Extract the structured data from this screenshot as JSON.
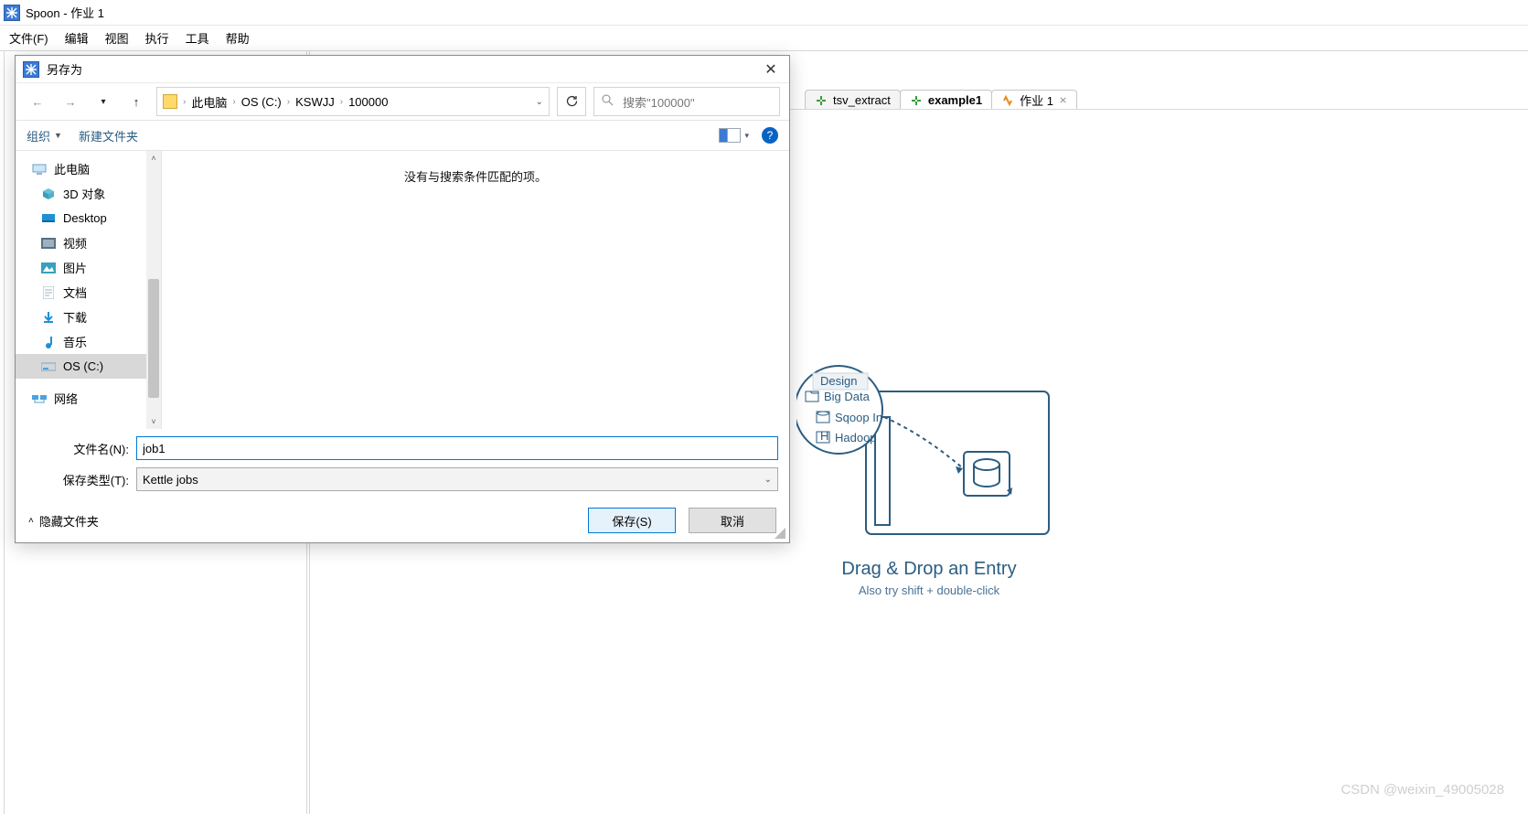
{
  "app": {
    "title": "Spoon - 作业 1",
    "menubar": [
      "文件(F)",
      "编辑",
      "视图",
      "执行",
      "工具",
      "帮助"
    ]
  },
  "tabs": [
    {
      "label": "tsv_extract",
      "kind": "trans",
      "active": false
    },
    {
      "label": "example1",
      "kind": "trans",
      "active": true
    },
    {
      "label": "作业 1",
      "kind": "job",
      "active": false,
      "closable": true,
      "close_glyph": "⨯"
    }
  ],
  "canvas": {
    "dd_title": "Drag & Drop an Entry",
    "dd_sub": "Also try shift + double-click",
    "design_label": "Design",
    "bigdata_label": "Big Data",
    "sqoop_label": "Sqoop In",
    "hadoop_label": "Hadoop"
  },
  "dialog": {
    "title": "另存为",
    "breadcrumb": [
      "此电脑",
      "OS (C:)",
      "KSWJJ",
      "100000"
    ],
    "search_placeholder": "搜索\"100000\"",
    "toolbar": {
      "organize": "组织",
      "newfolder": "新建文件夹",
      "help_glyph": "?",
      "view_drop": "▾"
    },
    "tree": [
      {
        "label": "此电脑",
        "icon": "pc",
        "top": true
      },
      {
        "label": "3D 对象",
        "icon": "3d"
      },
      {
        "label": "Desktop",
        "icon": "desktop"
      },
      {
        "label": "视频",
        "icon": "video"
      },
      {
        "label": "图片",
        "icon": "picture"
      },
      {
        "label": "文档",
        "icon": "doc"
      },
      {
        "label": "下载",
        "icon": "download"
      },
      {
        "label": "音乐",
        "icon": "music"
      },
      {
        "label": "OS (C:)",
        "icon": "drive",
        "selected": true
      },
      {
        "label": "网络",
        "icon": "network",
        "top": true
      }
    ],
    "empty_text": "没有与搜索条件匹配的项。",
    "filename_label": "文件名(N):",
    "filename_value": "job1",
    "savetype_label": "保存类型(T):",
    "savetype_value": "Kettle jobs",
    "hide_folders": "隐藏文件夹",
    "save_btn": "保存(S)",
    "cancel_btn": "取消"
  },
  "watermark": "CSDN @weixin_49005028"
}
